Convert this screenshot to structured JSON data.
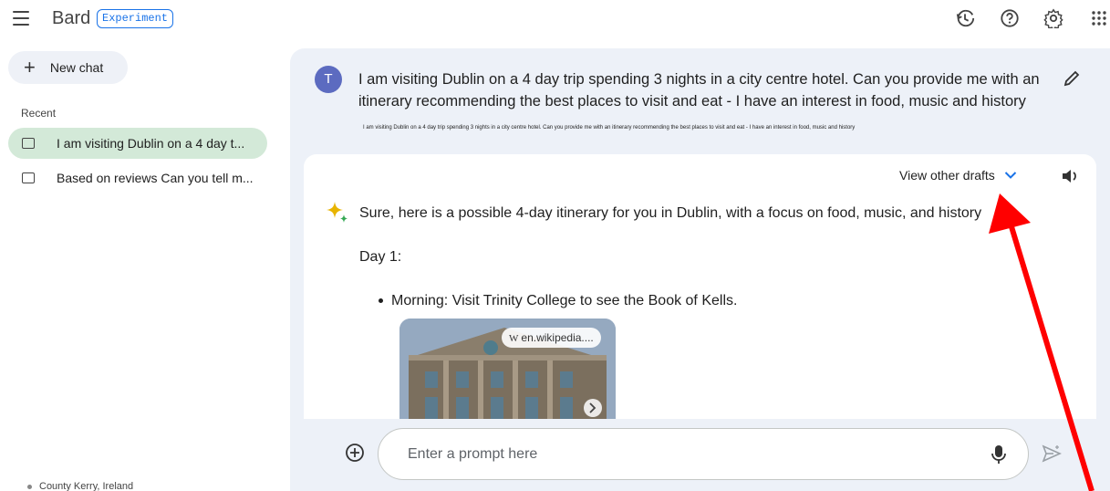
{
  "header": {
    "title": "Bard",
    "badge": "Experiment",
    "icons": [
      "menu-icon",
      "history-icon",
      "help-icon",
      "settings-icon",
      "apps-icon"
    ]
  },
  "sidebar": {
    "new_chat_label": "New chat",
    "recent_label": "Recent",
    "items": [
      {
        "label": "I am visiting Dublin on a 4 day t...",
        "active": true
      },
      {
        "label": "Based on reviews Can you tell m...",
        "active": false
      }
    ],
    "location": "County Kerry, Ireland"
  },
  "conversation": {
    "user_initial": "T",
    "user_prompt": "I am visiting Dublin on a 4 day trip spending 3 nights in a city centre hotel. Can you provide me with an itinerary recommending the best places to visit and eat - I have an interest in food, music and history",
    "user_prompt_small": "I am visiting Dublin on a 4 day trip spending 3 nights in a city centre hotel. Can you provide me with an itinerary recommending the best places to visit and eat - I have an interest in food, music and history",
    "view_drafts_label": "View other drafts",
    "response": {
      "intro": "Sure, here is a possible 4-day itinerary for you in Dublin, with a focus on food, music, and history",
      "day_heading": "Day 1:",
      "bullet": "Morning: Visit Trinity College to see the Book of Kells.",
      "image_source_icon": "W",
      "image_source": "en.wikipedia...."
    }
  },
  "input": {
    "placeholder": "Enter a prompt here"
  },
  "colors": {
    "accent": "#1a73e8",
    "active_chat_bg": "#d3e9d8",
    "main_bg": "#edf1f8",
    "annotation_arrow": "#ff0000"
  }
}
